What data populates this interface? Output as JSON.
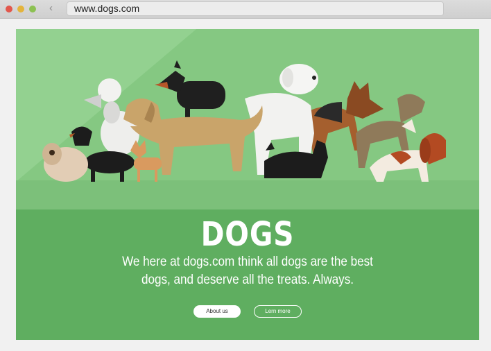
{
  "browser": {
    "url": "www.dogs.com",
    "back_glyph": "‹"
  },
  "hero": {
    "title": "DOGS",
    "tagline": "We here at dogs.com think all dogs are the best dogs, and deserve all the treats. Always."
  },
  "buttons": {
    "about": "About us",
    "learn": "Lern more"
  },
  "colors": {
    "hero_bg": "#85c882",
    "content_bg": "#5fae60"
  }
}
